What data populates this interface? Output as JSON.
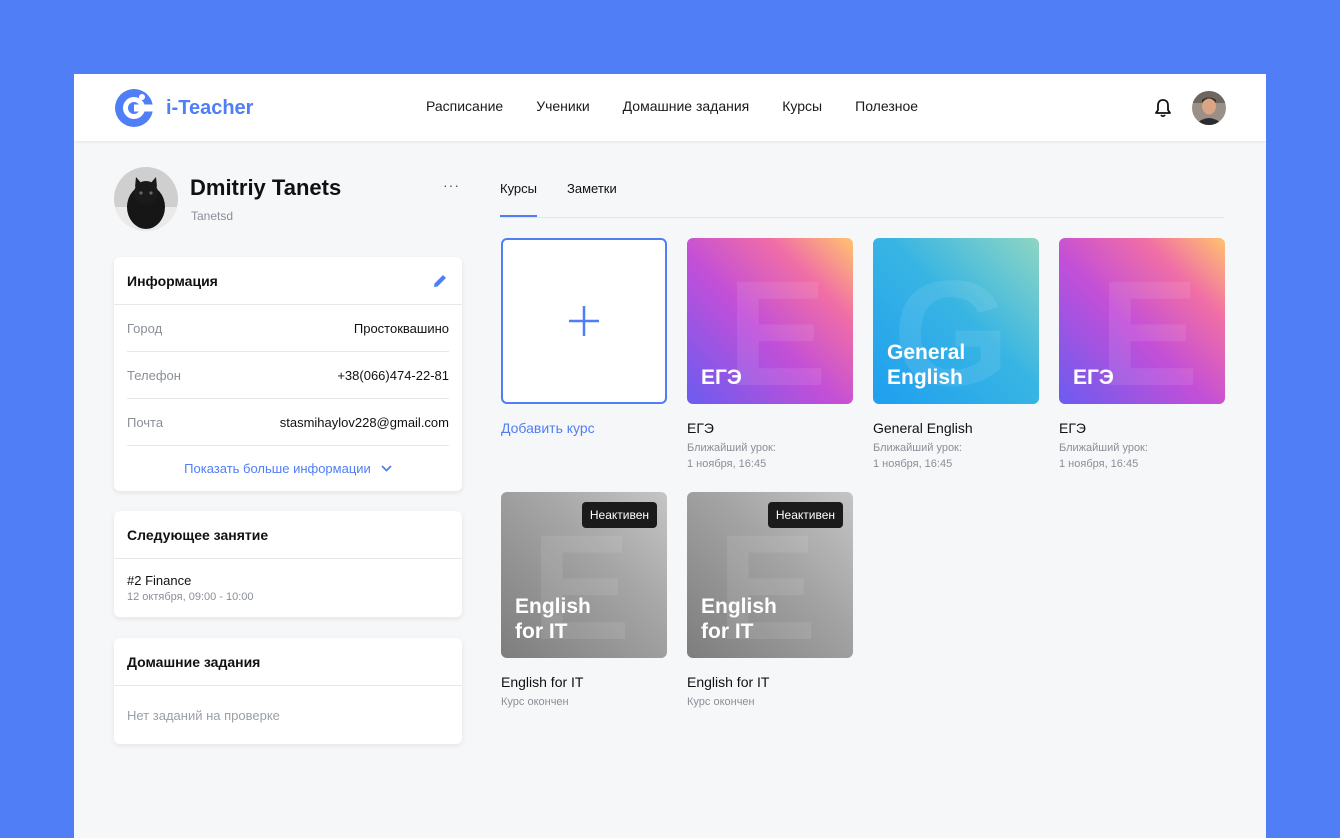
{
  "app": {
    "name": "i-Teacher"
  },
  "nav": [
    "Расписание",
    "Ученики",
    "Домашние задания",
    "Курсы",
    "Полезное"
  ],
  "profile": {
    "name": "Dmitriy Tanets",
    "username": "Tanetsd",
    "more": "···"
  },
  "info": {
    "title": "Информация",
    "rows": [
      {
        "label": "Город",
        "value": "Простоквашино"
      },
      {
        "label": "Телефон",
        "value": "+38(066)474-22-81"
      },
      {
        "label": "Почта",
        "value": "stasmihaylov228@gmail.com"
      }
    ],
    "show_more": "Показать больше информации"
  },
  "next_lesson": {
    "title": "Следующее занятие",
    "name": "#2  Finance",
    "time": "12 октября, 09:00 - 10:00"
  },
  "homework": {
    "title": "Домашние задания",
    "empty": "Нет заданий на проверке"
  },
  "tabs": [
    "Курсы",
    "Заметки"
  ],
  "add_course": {
    "label": "Добавить курс"
  },
  "courses": [
    {
      "tile_text": "ЕГЭ",
      "title": "ЕГЭ",
      "sub1": "Ближайший урок:",
      "sub2": "1 ноября, 16:45"
    },
    {
      "tile_text": "General\nEnglish",
      "title": "General English",
      "sub1": "Ближайший урок:",
      "sub2": "1 ноября, 16:45"
    },
    {
      "tile_text": "ЕГЭ",
      "title": "ЕГЭ",
      "sub1": "Ближайший урок:",
      "sub2": "1 ноября, 16:45"
    },
    {
      "tile_text": "English\nfor IT",
      "title": "English for IT",
      "sub1": "Курс окончен",
      "badge": "Неактивен"
    },
    {
      "tile_text": "English\nfor IT",
      "title": "English for IT",
      "sub1": "Курс окончен",
      "badge": "Неактивен"
    }
  ],
  "colors": {
    "accent": "#4f7ef7",
    "background": "#4f7ef7",
    "panel": "#f6f7f9"
  }
}
